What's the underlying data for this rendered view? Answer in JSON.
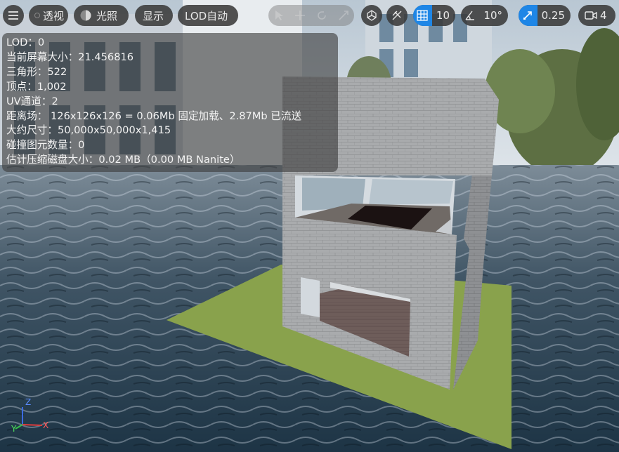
{
  "toolbar": {
    "menu_icon": "hamburger-menu-icon",
    "perspective_label": "透视",
    "lighting_label": "光照",
    "show_label": "显示",
    "lod_label": "LOD自动",
    "disabled_tools": [
      "select-arrow-icon",
      "move-icon",
      "rotate-icon",
      "scale-icon"
    ],
    "grid_snap_value": "10",
    "angle_snap_value": "10°",
    "scale_snap_value": "0.25",
    "camera_speed_value": "4",
    "accent_color": "#1e86e6"
  },
  "stats": {
    "lines": [
      "LOD：0",
      "当前屏幕大小：21.456816",
      "三角形：522",
      "顶点：1,002",
      "UV通道：2",
      "距离场： 126x126x126 = 0.06Mb 固定加载、2.87Mb 已流送",
      "大约尺寸：50,000x50,000x1,415",
      "碰撞图元数量：0",
      "估计压缩磁盘大小：0.02 MB（0.00 MB Nanite）"
    ]
  },
  "axis": {
    "x": "X",
    "y": "Y",
    "z": "Z"
  }
}
